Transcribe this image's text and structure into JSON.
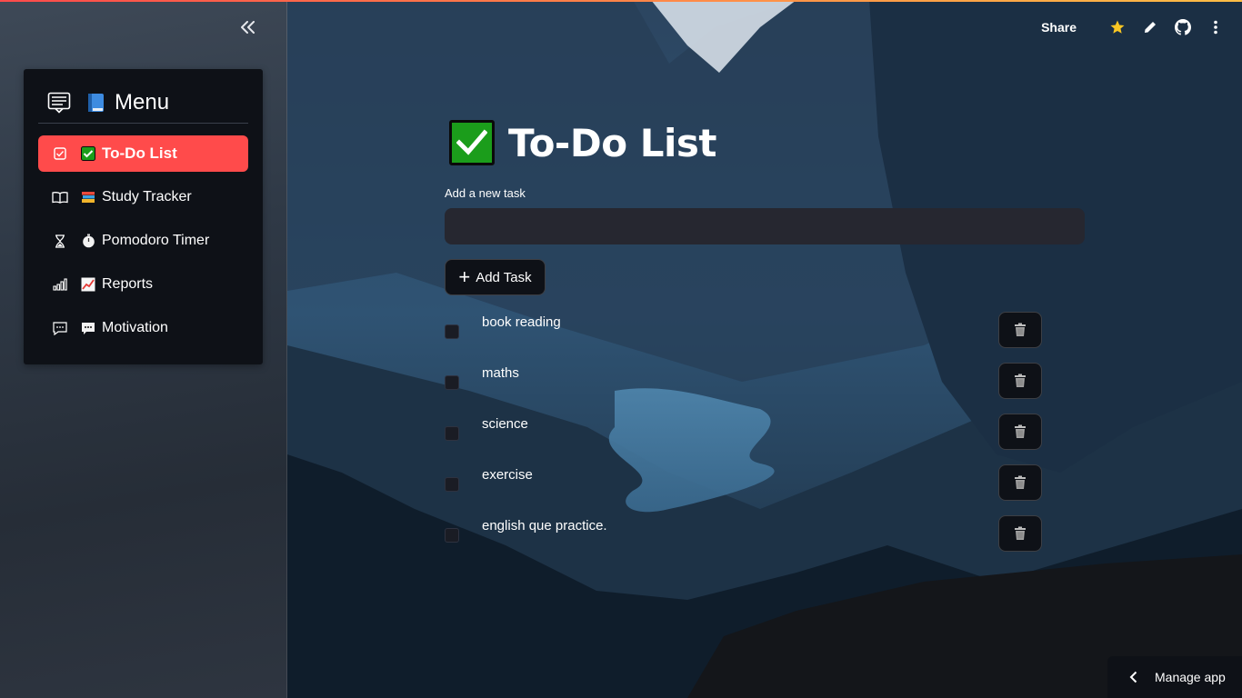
{
  "sidebar": {
    "collapse_icon": "double-chevron-left-icon",
    "menu": {
      "header_icon": "list-icon",
      "title_emoji_icon": "blue-book-icon",
      "title": "Menu",
      "items": [
        {
          "label": "To-Do List",
          "icon": "checkbox-icon",
          "emoji": "check-mark-button-icon",
          "active": true
        },
        {
          "label": "Study Tracker",
          "icon": "open-book-icon",
          "emoji": "books-icon",
          "active": false
        },
        {
          "label": "Pomodoro Timer",
          "icon": "hourglass-icon",
          "emoji": "stopwatch-icon",
          "active": false
        },
        {
          "label": "Reports",
          "icon": "bar-chart-icon",
          "emoji": "chart-increasing-icon",
          "active": false
        },
        {
          "label": "Motivation",
          "icon": "chat-icon",
          "emoji": "speech-bubble-icon",
          "active": false
        }
      ]
    }
  },
  "toolbar": {
    "share_label": "Share",
    "icons": [
      "star-icon",
      "edit-icon",
      "github-icon",
      "more-vert-icon"
    ]
  },
  "main": {
    "title": "To-Do List",
    "title_icon": "check-mark-button-icon",
    "input_label": "Add a new task",
    "input_value": "",
    "add_button_label": "Add Task",
    "tasks": [
      {
        "label": "book reading",
        "checked": false
      },
      {
        "label": "maths",
        "checked": false
      },
      {
        "label": "science",
        "checked": false
      },
      {
        "label": "exercise",
        "checked": false
      },
      {
        "label": "english que practice.",
        "checked": false
      }
    ]
  },
  "footer": {
    "manage_label": "Manage app"
  },
  "colors": {
    "accent": "#ff4b4b",
    "panel": "#0e1117",
    "input": "#262730",
    "check_green": "#1b9d1b"
  }
}
